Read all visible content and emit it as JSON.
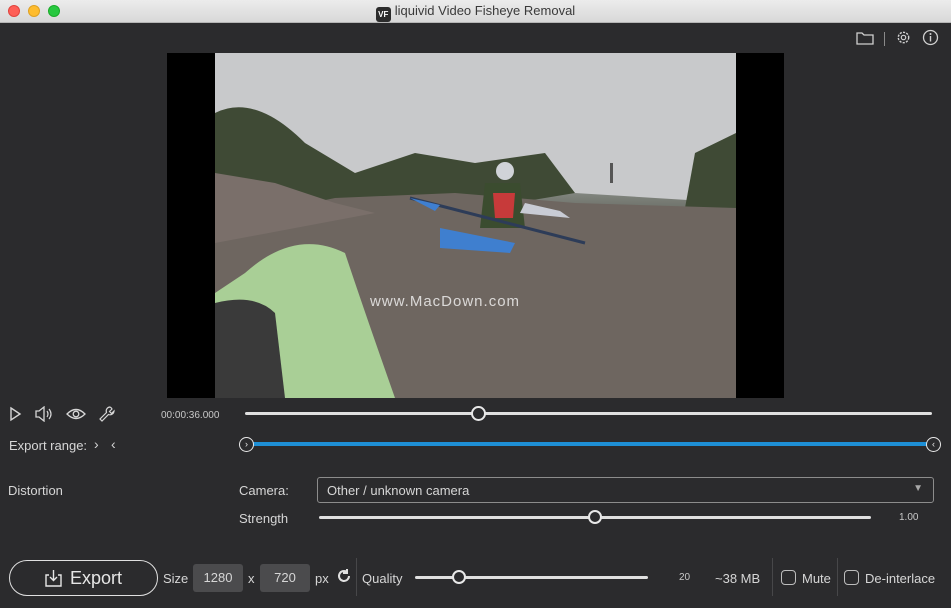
{
  "window": {
    "title": "liquivid Video Fisheye Removal",
    "app_icon_text": "VF"
  },
  "toolbar": {
    "icons": [
      "folder-icon",
      "gear-icon",
      "info-icon"
    ]
  },
  "video": {
    "watermark": "www.MacDown.com"
  },
  "playback": {
    "time": "00:00:36.000",
    "position_fraction": 0.34,
    "icons": [
      "play-icon",
      "speaker-icon",
      "eye-icon",
      "wrench-icon"
    ]
  },
  "export_range": {
    "label": "Export range:",
    "start_fraction": 0.0,
    "end_fraction": 1.0
  },
  "distortion": {
    "section_label": "Distortion",
    "camera_label": "Camera:",
    "camera_value": "Other / unknown camera",
    "strength_label": "Strength",
    "strength_value": "1.00",
    "strength_fraction": 0.5
  },
  "bottom": {
    "export_label": "Export",
    "size_label": "Size",
    "width": "1280",
    "x_label": "x",
    "height": "720",
    "px_label": "px",
    "quality_label": "Quality",
    "quality_value": "20",
    "quality_fraction": 0.19,
    "file_size": "~38 MB",
    "mute_label": "Mute",
    "deinterlace_label": "De-interlace"
  },
  "colors": {
    "accent": "#1e8fd5",
    "background": "#2b2b2d"
  }
}
